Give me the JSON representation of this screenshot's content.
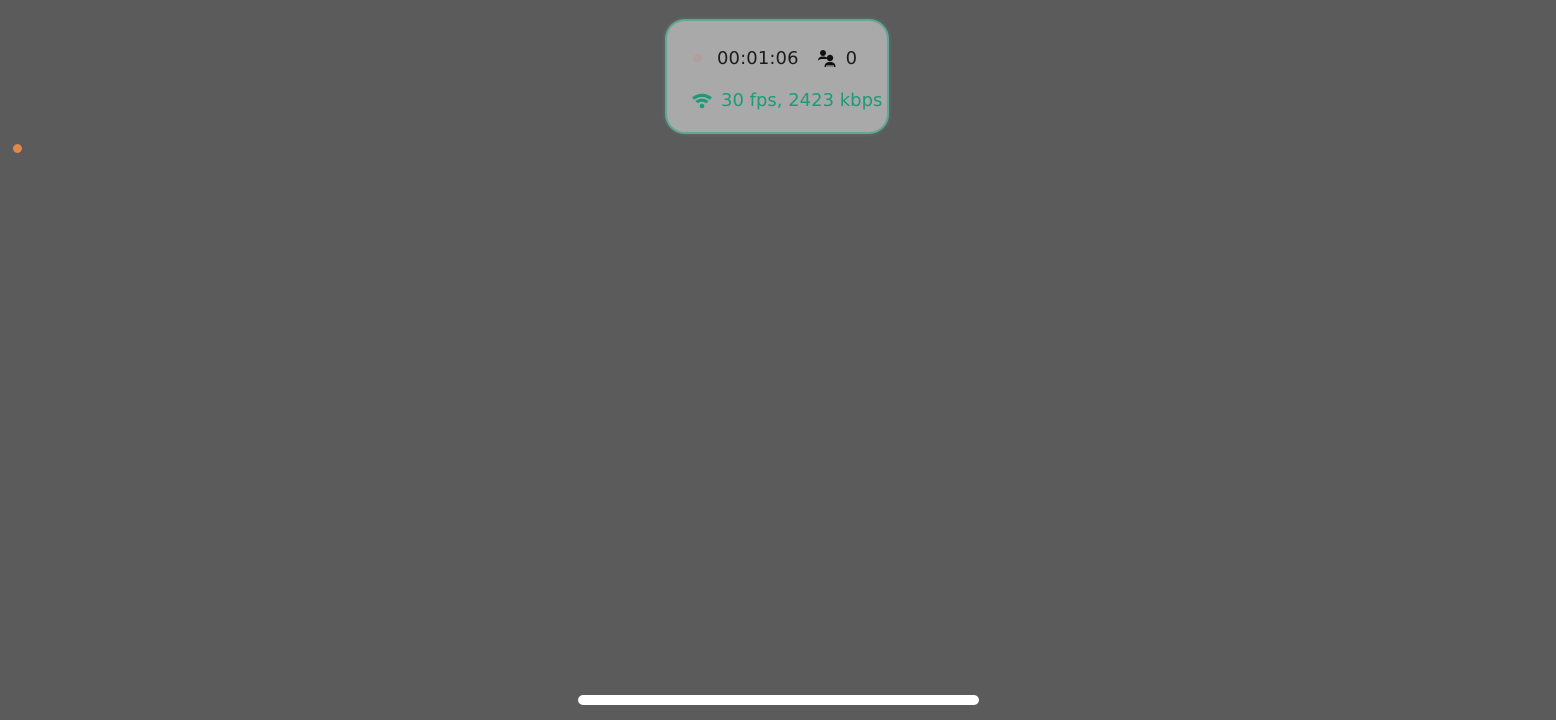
{
  "status_card": {
    "timer": "00:01:06",
    "viewers_count": "0",
    "stream_stats": "30 fps, 2423 kbps",
    "icons": {
      "recording": "recording-dot-icon",
      "viewers": "viewers-icon",
      "connection": "wifi-icon"
    },
    "colors": {
      "accent": "#1d9b78",
      "border": "#5fa895"
    }
  },
  "indicators": {
    "status_dot_color": "#e0874a"
  }
}
